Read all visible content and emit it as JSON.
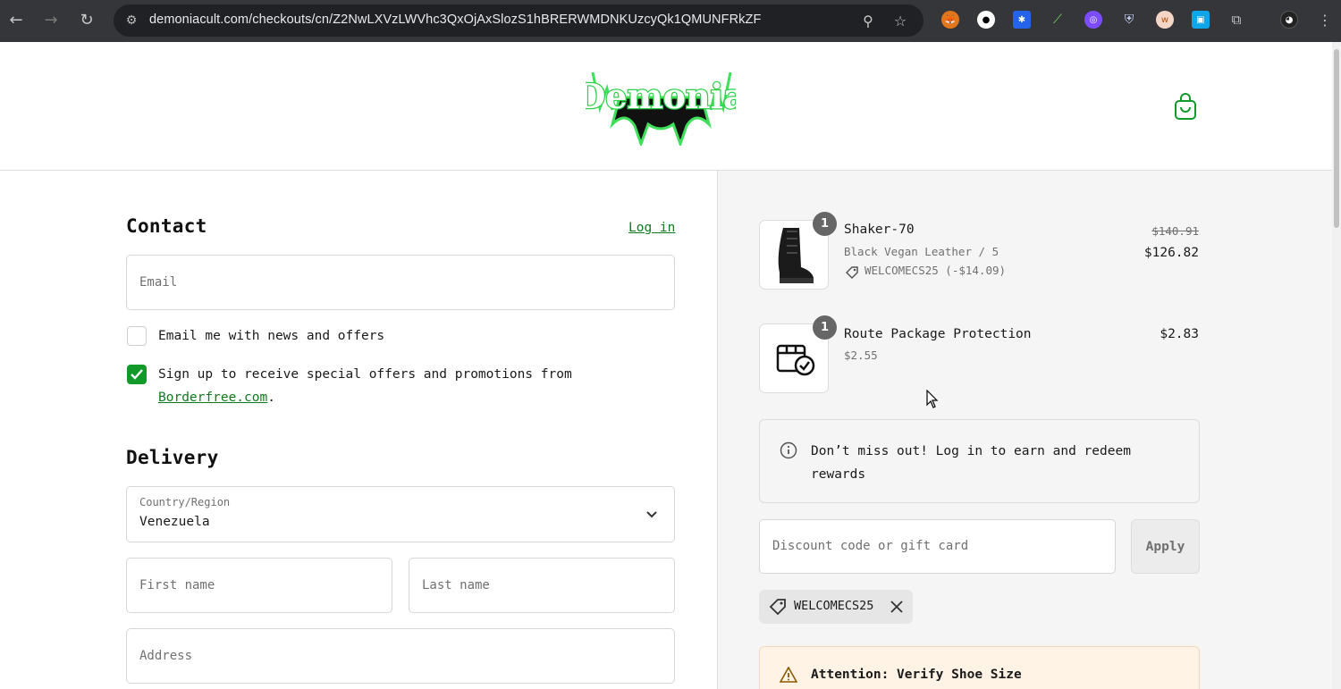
{
  "browser": {
    "url": "demoniacult.com/checkouts/cn/Z2NwLXVzLWVhc3QxOjAxSlozS1hBRERWMDNKUzcyQk1QMUNFRkZF"
  },
  "header": {
    "logo_alt": "Demonia",
    "brand_color": "#119a2a"
  },
  "contact": {
    "title": "Contact",
    "login_label": "Log in",
    "email_placeholder": "Email",
    "news_checkbox_label": "Email me with news and offers",
    "news_checked": false,
    "signup_label_prefix": "Sign up to receive special offers and promotions from",
    "signup_link": "Borderfree.com",
    "signup_suffix": ".",
    "signup_checked": true
  },
  "delivery": {
    "title": "Delivery",
    "country_label": "Country/Region",
    "country_value": "Venezuela",
    "first_name_placeholder": "First name",
    "last_name_placeholder": "Last name",
    "address_placeholder": "Address"
  },
  "summary": {
    "items": [
      {
        "qty": "1",
        "name": "Shaker-70",
        "variant": "Black Vegan Leather / 5",
        "discount": "WELCOMECS25 (-$14.09)",
        "original_price": "$140.91",
        "price": "$126.82"
      },
      {
        "qty": "1",
        "name": "Route Package Protection",
        "variant": "$2.55",
        "price": "$2.83"
      }
    ],
    "notice": "Don’t miss out! Log in to earn and redeem rewards",
    "discount_placeholder": "Discount code or gift card",
    "apply_label": "Apply",
    "applied_code": "WELCOMECS25",
    "attention_text": "Attention: Verify Shoe Size"
  }
}
